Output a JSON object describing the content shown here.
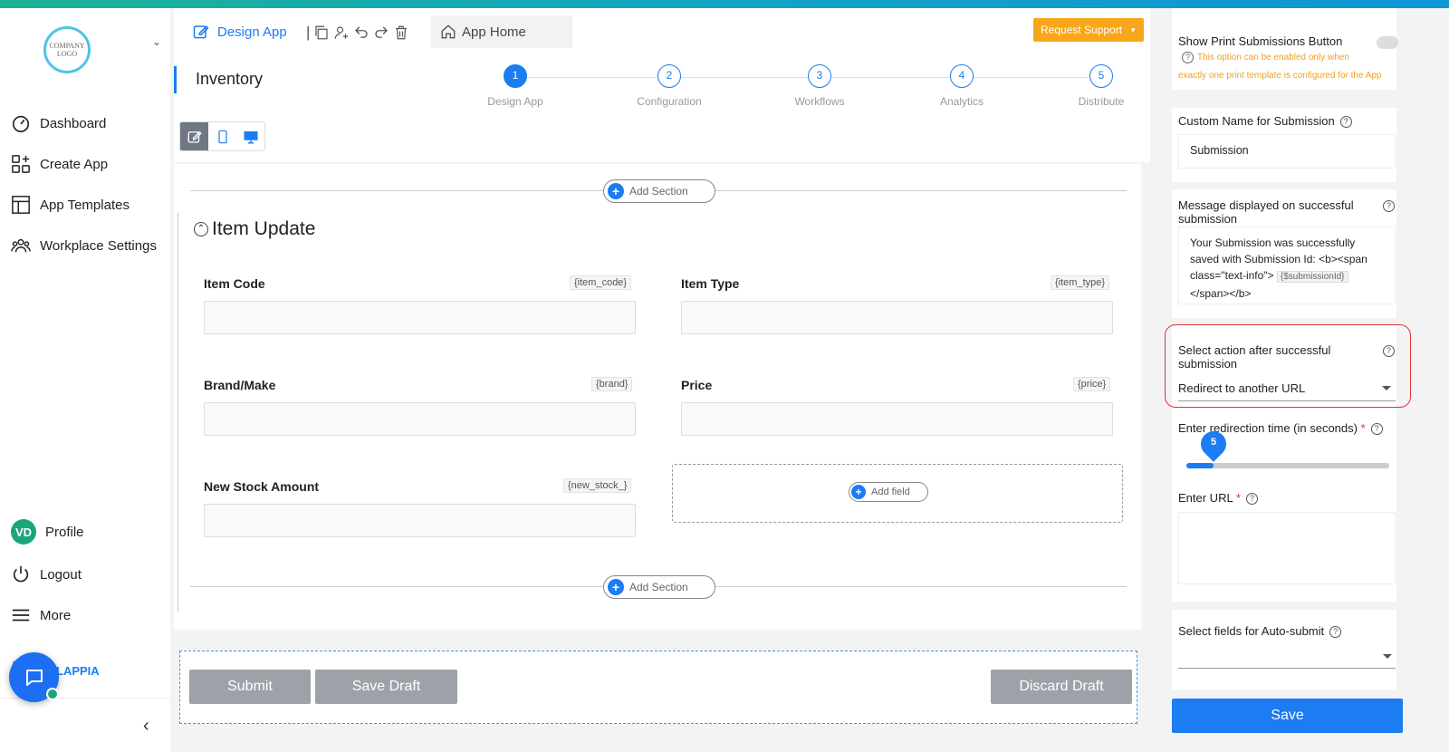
{
  "sidebar": {
    "logo_text": "COMPANY LOGO",
    "items": [
      {
        "label": "Dashboard",
        "icon": "dashboard-icon"
      },
      {
        "label": "Create App",
        "icon": "create-app-icon"
      },
      {
        "label": "App Templates",
        "icon": "templates-icon"
      },
      {
        "label": "Workplace Settings",
        "icon": "workplace-icon"
      }
    ],
    "profile": {
      "initials": "VD",
      "label": "Profile"
    },
    "logout": "Logout",
    "more": "More",
    "brand_text": "LAPPIA"
  },
  "toolbar": {
    "design_app": "Design App",
    "app_home": "App Home",
    "request_support": "Request Support"
  },
  "header": {
    "app_name": "Inventory",
    "steps": [
      {
        "num": "1",
        "label": "Design App"
      },
      {
        "num": "2",
        "label": "Configuration"
      },
      {
        "num": "3",
        "label": "Workflows"
      },
      {
        "num": "4",
        "label": "Analytics"
      },
      {
        "num": "5",
        "label": "Distribute"
      }
    ],
    "active_step": 1
  },
  "canvas": {
    "add_section": "Add Section",
    "section_title": "Item Update",
    "fields": [
      {
        "label": "Item Code",
        "key": "{item_code}"
      },
      {
        "label": "Item Type",
        "key": "{item_type}"
      },
      {
        "label": "Brand/Make",
        "key": "{brand}"
      },
      {
        "label": "Price",
        "key": "{price}"
      },
      {
        "label": "New Stock Amount",
        "key": "{new_stock_}"
      }
    ],
    "add_field": "Add field"
  },
  "footer": {
    "submit": "Submit",
    "save_draft": "Save Draft",
    "discard_draft": "Discard Draft"
  },
  "settings": {
    "print_label": "Show Print Submissions Button",
    "print_warning_1": "This option can be enabled only when",
    "print_warning_2": "exactly one print template is configured for the App",
    "custom_name_label": "Custom Name for Submission",
    "custom_name_value": "Submission",
    "message_label": "Message displayed on successful submission",
    "message_value_1": "Your Submission was successfully",
    "message_value_2": "saved with Submission Id: <b><span",
    "message_value_3": "class=\"text-info\">",
    "message_value_tag": "{$submissionId}",
    "message_value_4": "</span></b>",
    "action_label": "Select action after successful submission",
    "action_value": "Redirect to another URL",
    "redirect_time_label": "Enter redirection time (in seconds)",
    "redirect_time_value": "5",
    "redirect_time_max": 60,
    "url_label": "Enter URL",
    "autosubmit_label": "Select fields for Auto-submit",
    "save": "Save"
  }
}
